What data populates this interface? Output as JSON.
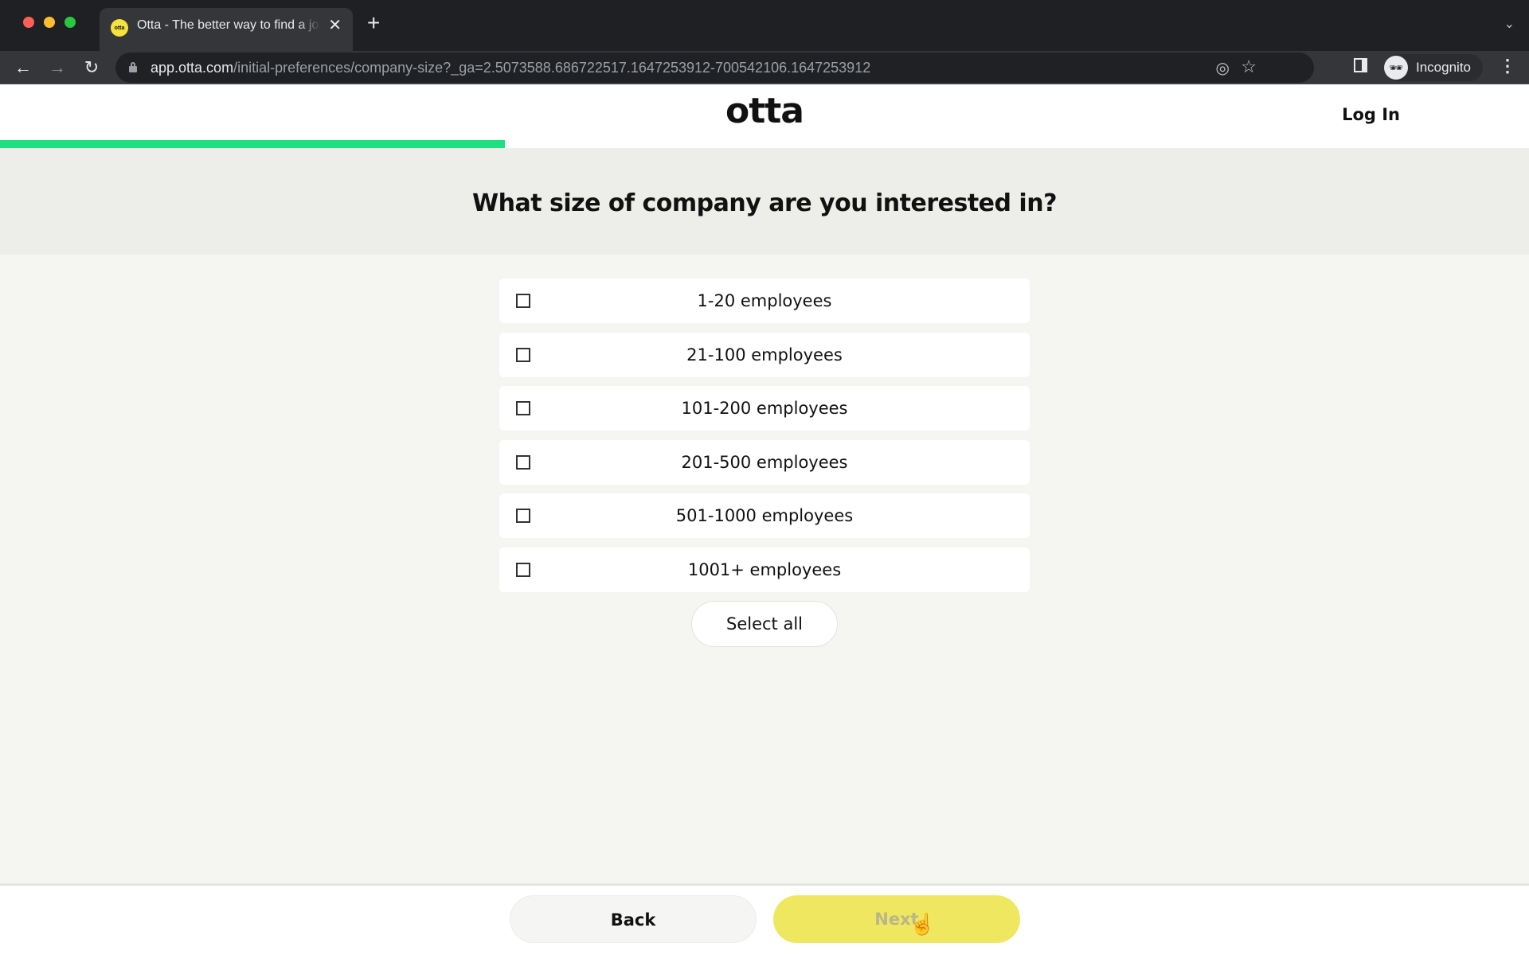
{
  "browser": {
    "tab": {
      "favicon_text": "otta",
      "title": "Otta - The better way to find a job"
    },
    "new_tab_label": "+",
    "url_host": "app.otta.com",
    "url_path": "/initial-preferences/company-size?_ga=2.5073588.686722517.1647253912-700542106.1647253912",
    "profile_label": "Incognito",
    "icons": {
      "back": "←",
      "forward": "→",
      "reload": "↻",
      "close": "✕",
      "dropdown": "⌄",
      "eye_off": "◎",
      "star": "☆",
      "incognito": "🕶",
      "menu": "⋮"
    }
  },
  "header": {
    "logo": "otta",
    "login_label": "Log In",
    "progress_percent": 33,
    "progress_color": "#1ee07f"
  },
  "question": "What size of company are you interested in?",
  "options": [
    {
      "label": "1-20 employees",
      "checked": false
    },
    {
      "label": "21-100 employees",
      "checked": false
    },
    {
      "label": "101-200 employees",
      "checked": false
    },
    {
      "label": "201-500 employees",
      "checked": false
    },
    {
      "label": "501-1000 employees",
      "checked": false
    },
    {
      "label": "1001+ employees",
      "checked": false
    }
  ],
  "select_all_label": "Select all",
  "footer": {
    "back_label": "Back",
    "next_label": "Next",
    "next_color": "#efe75f",
    "next_disabled": true
  },
  "cursor_icon": "☝"
}
